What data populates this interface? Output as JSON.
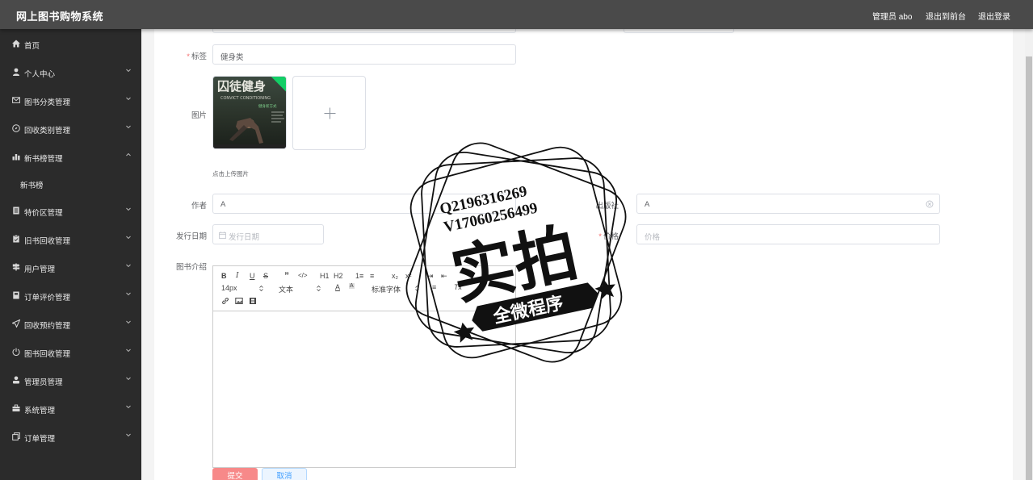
{
  "header": {
    "title": "网上图书购物系统",
    "admin_label": "管理员 abo",
    "front_link": "退出到前台",
    "logout_link": "退出登录"
  },
  "sidebar": {
    "items": [
      {
        "label": "首页",
        "icon": "home-icon"
      },
      {
        "label": "个人中心",
        "icon": "user-icon"
      },
      {
        "label": "图书分类管理",
        "icon": "mail-icon"
      },
      {
        "label": "回收类别管理",
        "icon": "compass-icon"
      },
      {
        "label": "新书榜管理",
        "icon": "chart-icon",
        "expanded": true
      },
      {
        "label": "新书榜",
        "sub": true
      },
      {
        "label": "特价区管理",
        "icon": "document-icon"
      },
      {
        "label": "旧书回收管理",
        "icon": "clipboard-icon"
      },
      {
        "label": "用户管理",
        "icon": "signpost-icon"
      },
      {
        "label": "订单评价管理",
        "icon": "notebook-icon"
      },
      {
        "label": "回收预约管理",
        "icon": "send-icon"
      },
      {
        "label": "图书回收管理",
        "icon": "power-icon"
      },
      {
        "label": "管理员管理",
        "icon": "person-icon"
      },
      {
        "label": "系统管理",
        "icon": "briefcase-icon"
      },
      {
        "label": "订单管理",
        "icon": "copy-icon"
      }
    ]
  },
  "form": {
    "tag_label": "标签",
    "tag_value": "健身类",
    "image_label": "图片",
    "upload_tip": "点击上传图片",
    "author_label": "作者",
    "author_value": "A",
    "publisher_label": "出版社",
    "publisher_value": "A",
    "date_label": "发行日期",
    "date_placeholder": "发行日期",
    "price_label": "价格",
    "price_placeholder": "价格",
    "intro_label": "图书介绍",
    "submit_label": "提交",
    "cancel_label": "取消"
  },
  "editor": {
    "row1": [
      "B",
      "I",
      "U",
      "S",
      "”",
      "</>",
      "H1",
      "H2",
      "1≡",
      "≡",
      "x₂",
      "x²",
      "⇥",
      "⇤"
    ],
    "font_size": "14px",
    "text_type": "文本",
    "font_family": "标准字体",
    "clear_format": "Tx"
  },
  "book_cover": {
    "title_cn": "囚徒健身",
    "title_en": "CONVICT CONDITIONING",
    "subtitle": "健身新方式"
  },
  "watermark": {
    "line1": "Q2196316269",
    "line2": "V17060256499",
    "main": "实拍",
    "banner": "全微程序"
  }
}
